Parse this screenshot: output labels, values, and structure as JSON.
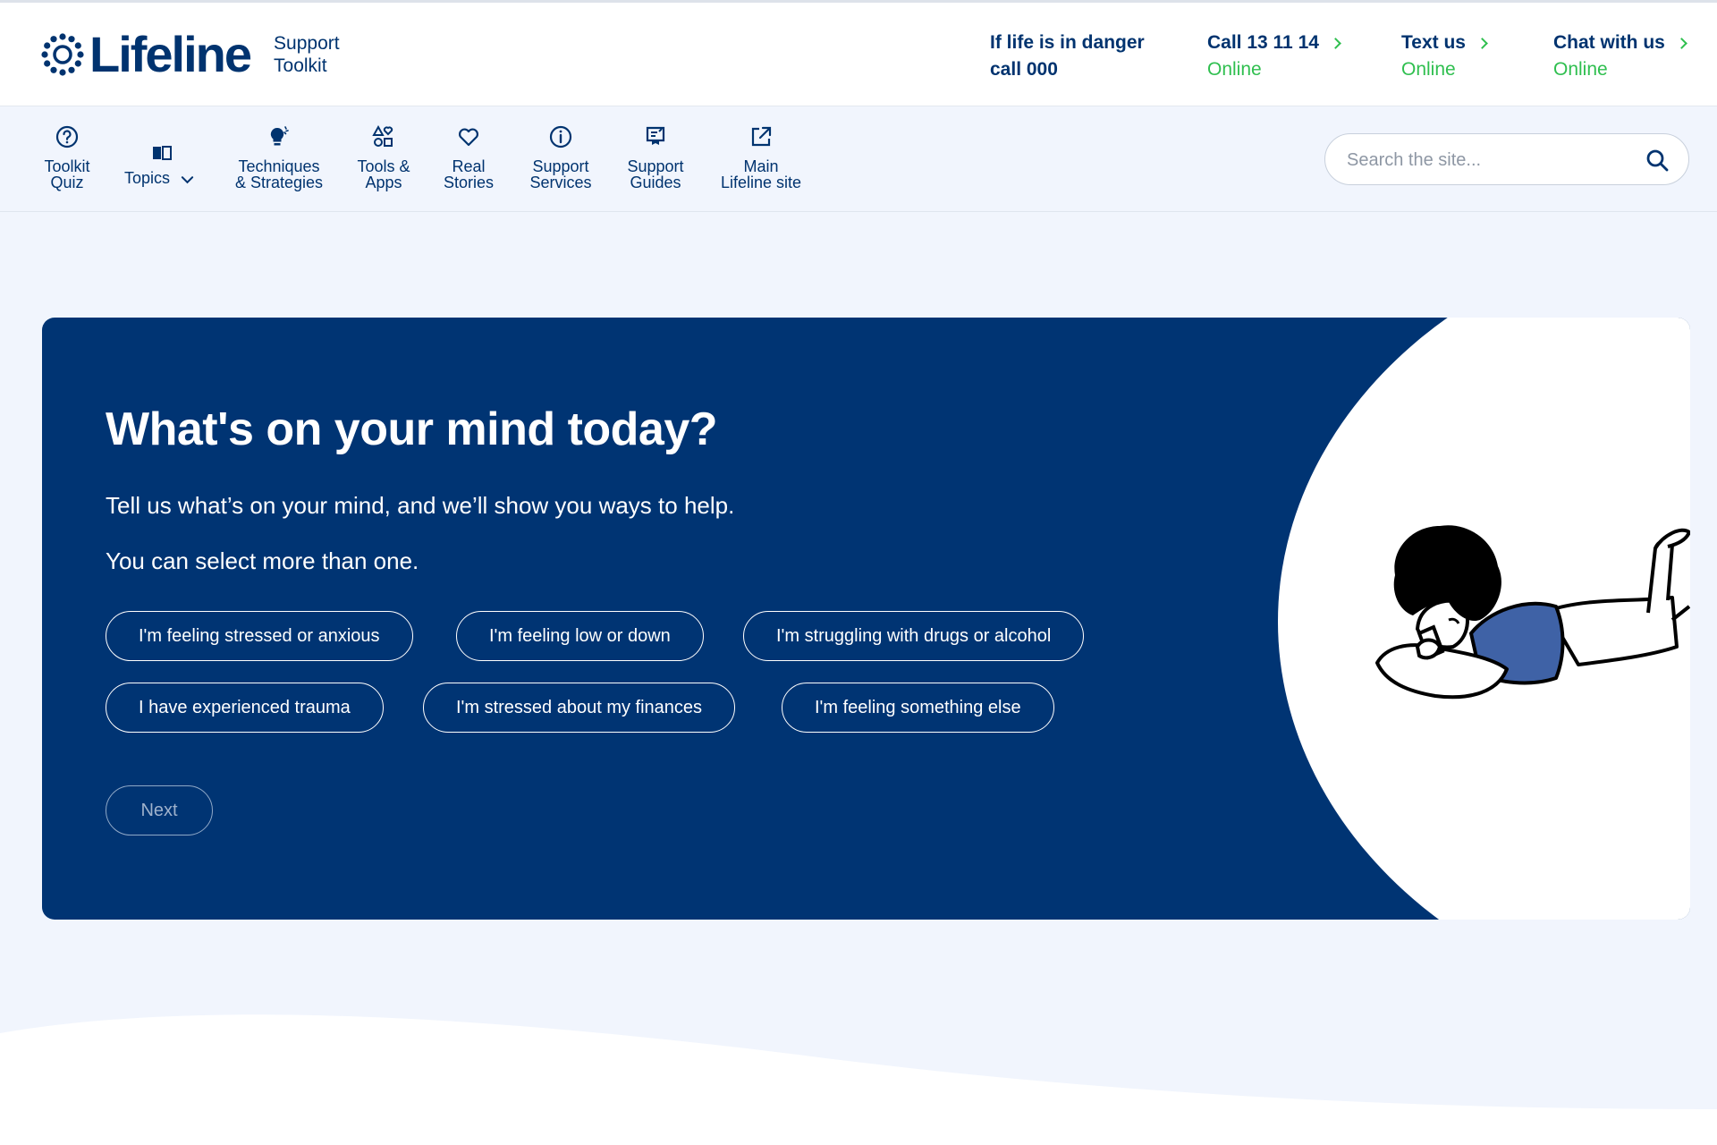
{
  "header": {
    "brand": "Lifeline",
    "subtitle": "Support\nToolkit",
    "danger": {
      "line1": "If life is in danger",
      "line2": "call 000"
    },
    "call": {
      "label": "Call 13 11 14",
      "status": "Online"
    },
    "text": {
      "label": "Text us",
      "status": "Online"
    },
    "chat": {
      "label": "Chat with us",
      "status": "Online"
    }
  },
  "nav": {
    "items": [
      {
        "label": "Toolkit\nQuiz",
        "icon": "question-circle-icon"
      },
      {
        "label": "Topics",
        "icon": "book-icon"
      },
      {
        "label": "Techniques\n& Strategies",
        "icon": "lightbulb-icon"
      },
      {
        "label": "Tools &\nApps",
        "icon": "shapes-icon"
      },
      {
        "label": "Real\nStories",
        "icon": "heart-icon"
      },
      {
        "label": "Support\nServices",
        "icon": "info-circle-icon"
      },
      {
        "label": "Support\nGuides",
        "icon": "guide-icon"
      },
      {
        "label": "Main\nLifeline site",
        "icon": "external-link-icon"
      }
    ],
    "search_placeholder": "Search the site..."
  },
  "hero": {
    "title": "What's on your mind today?",
    "intro": "Tell us what’s on your mind, and we’ll show you ways to help.",
    "hint": "You can select more than one.",
    "options": [
      "I'm feeling stressed or anxious",
      "I'm feeling low or down",
      "I'm struggling with drugs or alcohol",
      "I have experienced trauma",
      "I'm stressed about my finances",
      "I'm feeling something else"
    ],
    "next_label": "Next"
  },
  "colors": {
    "navy": "#003473",
    "brand_text": "#00336f",
    "online_green": "#2fbf4f",
    "page_bg": "#f1f5fd",
    "illustration_blue": "#3f62a6"
  }
}
